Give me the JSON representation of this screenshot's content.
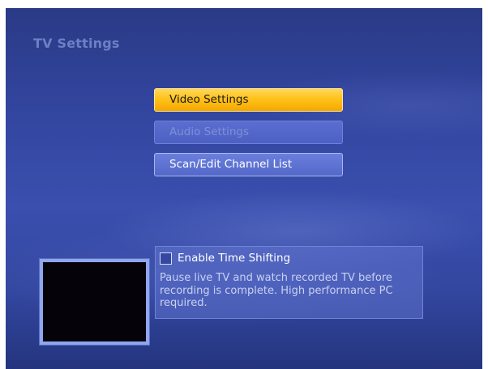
{
  "page": {
    "title": "TV Settings"
  },
  "menu": {
    "items": [
      {
        "label": "Video Settings",
        "state": "focused"
      },
      {
        "label": "Audio Settings",
        "state": "disabled"
      },
      {
        "label": "Scan/Edit Channel List",
        "state": "normal"
      }
    ]
  },
  "time_shifting": {
    "checkbox_label": "Enable Time Shifting",
    "checked": false,
    "description": "Pause live TV and watch recorded TV before recording is complete. High performance PC required."
  },
  "colors": {
    "background": "#3346a0",
    "focus_accent": "#ffc21a",
    "title_text": "#6f7fc4"
  }
}
